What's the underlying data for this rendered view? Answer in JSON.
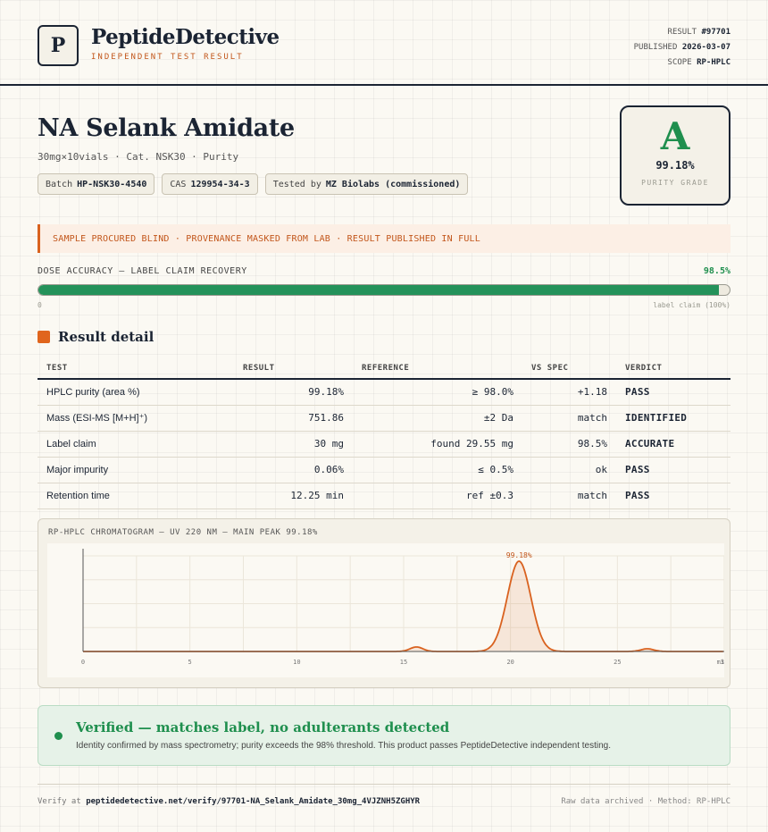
{
  "brand": {
    "logo_letter": "P",
    "name": "PeptideDetective",
    "tagline": "INDEPENDENT TEST RESULT"
  },
  "meta": {
    "result_label": "RESULT",
    "result_value": "#97701",
    "published_label": "PUBLISHED",
    "published_value": "2026-03-07",
    "scope_label": "SCOPE",
    "scope_value": "RP-HPLC"
  },
  "product": {
    "name": "NA Selank Amidate",
    "subtitle": "30mg×10vials · Cat. NSK30 · Purity",
    "chips": [
      {
        "label": "Batch",
        "value": "HP-NSK30-4540"
      },
      {
        "label": "CAS",
        "value": "129954-34-3"
      },
      {
        "label": "Tested by",
        "value": "MZ Biolabs (commissioned)"
      }
    ]
  },
  "grade": {
    "letter": "A",
    "value": "99.18%",
    "label": "PURITY GRADE",
    "color": "#1f8f4e"
  },
  "notice": "SAMPLE PROCURED BLIND · PROVENANCE MASKED FROM LAB · RESULT PUBLISHED IN FULL",
  "dose": {
    "label": "DOSE ACCURACY — LABEL CLAIM RECOVERY",
    "value_text": "98.5%",
    "fraction": 0.985,
    "min_label": "0",
    "max_label": "label claim (100%)"
  },
  "section_title": "Result detail",
  "table": {
    "headers": [
      "TEST",
      "RESULT",
      "REFERENCE",
      "VS SPEC",
      "VERDICT"
    ],
    "rows": [
      {
        "test": "HPLC purity (area %)",
        "result": "99.18%",
        "reference": "≥ 98.0%",
        "vs_spec": "+1.18",
        "verdict": "PASS"
      },
      {
        "test": "Mass (ESI-MS [M+H]⁺)",
        "result": "751.86",
        "reference": "±2 Da",
        "vs_spec": "match",
        "verdict": "IDENTIFIED"
      },
      {
        "test": "Label claim",
        "result": "30 mg",
        "reference": "found 29.55 mg",
        "vs_spec": "98.5%",
        "verdict": "ACCURATE"
      },
      {
        "test": "Major impurity",
        "result": "0.06%",
        "reference": "≤ 0.5%",
        "vs_spec": "ok",
        "verdict": "PASS"
      },
      {
        "test": "Retention time",
        "result": "12.25 min",
        "reference": "ref ±0.3",
        "vs_spec": "match",
        "verdict": "PASS"
      }
    ]
  },
  "chart_data": {
    "type": "line",
    "title": "RP-HPLC CHROMATOGRAM — UV 220 NM — MAIN PEAK 99.18%",
    "xlabel": "",
    "ylabel": "",
    "x_ticks": [
      "0",
      "5",
      "10",
      "15",
      "20",
      "25",
      "30"
    ],
    "x_end_label": "min",
    "xlim": [
      0,
      30
    ],
    "peak_label": "99.18%",
    "peaks": [
      {
        "rt": 15.6,
        "height": 0.05
      },
      {
        "rt": 20.4,
        "height": 1.0
      },
      {
        "rt": 26.4,
        "height": 0.03
      }
    ],
    "baseline": 0.0,
    "line_color": "#d9621f",
    "grid": true
  },
  "verified": {
    "title": "Verified — matches label, no adulterants detected",
    "description": "Identity confirmed by mass spectrometry; purity exceeds the 98% threshold. This product passes PeptideDetective independent testing."
  },
  "footer": {
    "verify_prefix": "Verify at",
    "verify_url": "peptidedetective.net/verify/97701-NA_Selank_Amidate_30mg_4VJZNH5ZGHYR",
    "right": "Raw data archived · Method: RP-HPLC"
  }
}
